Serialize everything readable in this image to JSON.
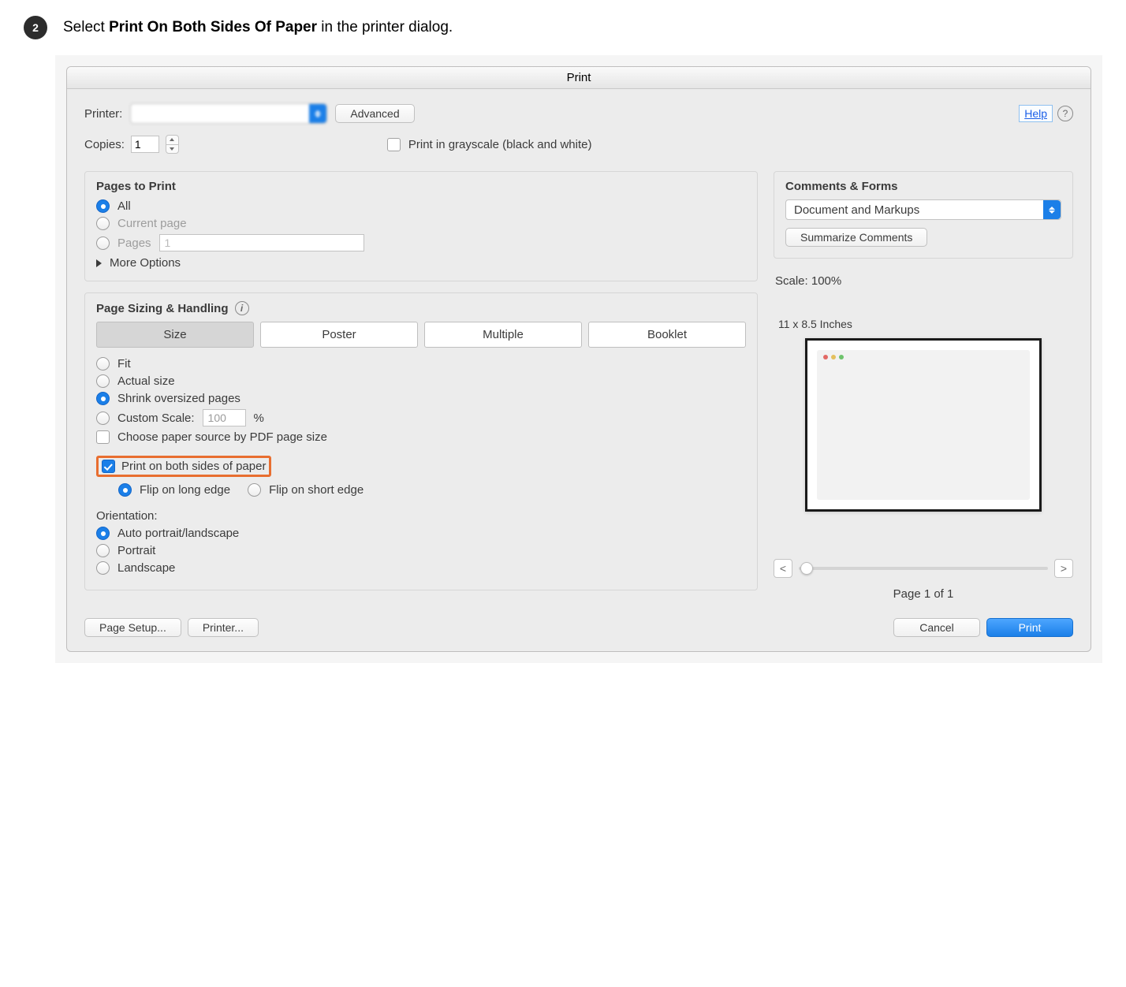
{
  "step": {
    "number": "2",
    "text_prefix": "Select ",
    "text_bold": "Print On Both Sides Of Paper",
    "text_suffix": " in the printer dialog."
  },
  "dialog_title": "Print",
  "row1": {
    "printer_label": "Printer:",
    "advanced_btn": "Advanced",
    "help_link": "Help"
  },
  "row2": {
    "copies_label": "Copies:",
    "copies_value": "1",
    "grayscale_label": "Print in grayscale (black and white)"
  },
  "pages_panel": {
    "title": "Pages to Print",
    "opt_all": "All",
    "opt_current": "Current page",
    "opt_pages": "Pages",
    "pages_value": "1",
    "more_options": "More Options"
  },
  "sizing_panel": {
    "title": "Page Sizing & Handling",
    "seg_size": "Size",
    "seg_poster": "Poster",
    "seg_multiple": "Multiple",
    "seg_booklet": "Booklet",
    "opt_fit": "Fit",
    "opt_actual": "Actual size",
    "opt_shrink": "Shrink oversized pages",
    "opt_custom": "Custom Scale:",
    "custom_value": "100",
    "percent": "%",
    "choose_paper": "Choose paper source by PDF page size",
    "both_sides": "Print on both sides of paper",
    "flip_long": "Flip on long edge",
    "flip_short": "Flip on short edge",
    "orientation_title": "Orientation:",
    "ori_auto": "Auto portrait/landscape",
    "ori_portrait": "Portrait",
    "ori_landscape": "Landscape"
  },
  "comments_panel": {
    "title": "Comments & Forms",
    "select_value": "Document and Markups",
    "summarize_btn": "Summarize Comments"
  },
  "scale_text": "Scale: 100%",
  "preview": {
    "paper_dim": "11 x 8.5 Inches",
    "nav_prev": "<",
    "nav_next": ">",
    "page_of": "Page 1 of 1"
  },
  "footer": {
    "page_setup": "Page Setup...",
    "printer_btn": "Printer...",
    "cancel": "Cancel",
    "print": "Print"
  }
}
